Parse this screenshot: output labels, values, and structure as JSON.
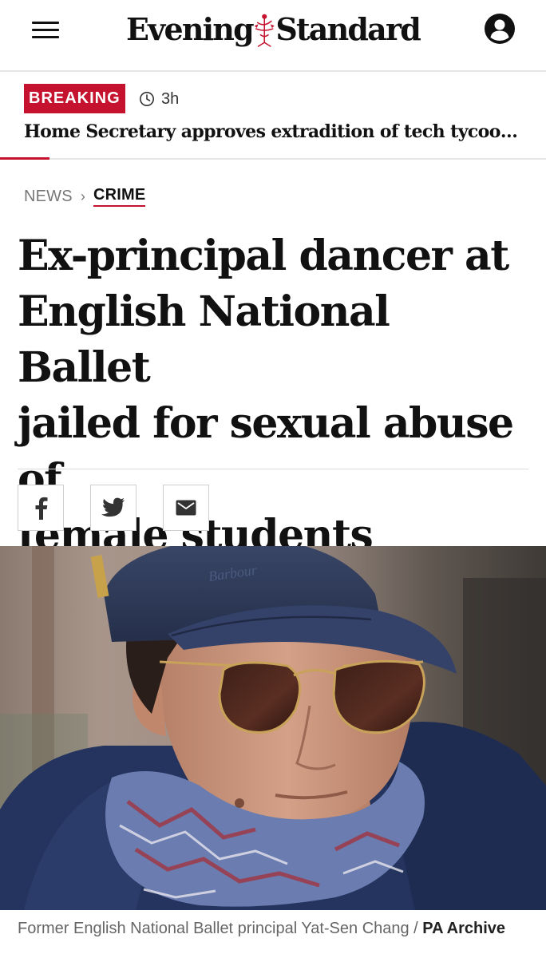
{
  "header": {
    "logo_left": "Evening",
    "logo_right": "Standard",
    "icons": {
      "menu": "hamburger-menu-icon",
      "account": "account-icon",
      "emblem": "masthead-emblem-icon"
    }
  },
  "breaking": {
    "badge": "BREAKING",
    "time": "3h",
    "headline": "Home Secretary approves extradition of tech tycoon to …"
  },
  "breadcrumb": {
    "parent": "NEWS",
    "separator": "›",
    "current": "CRIME"
  },
  "article": {
    "headline_lines": [
      "Ex-principal dancer at",
      "English National Ballet",
      "jailed for sexual abuse of",
      "female students"
    ]
  },
  "share": [
    {
      "name": "facebook",
      "icon": "facebook-icon"
    },
    {
      "name": "twitter",
      "icon": "twitter-icon"
    },
    {
      "name": "email",
      "icon": "email-icon"
    }
  ],
  "photo": {
    "cap_text": "Barbour",
    "caption": "Former English National Ballet principal Yat-Sen Chang",
    "caption_sep": " / ",
    "credit": "PA Archive"
  },
  "colors": {
    "accent": "#c4122f",
    "text": "#111111",
    "muted": "#777777"
  }
}
